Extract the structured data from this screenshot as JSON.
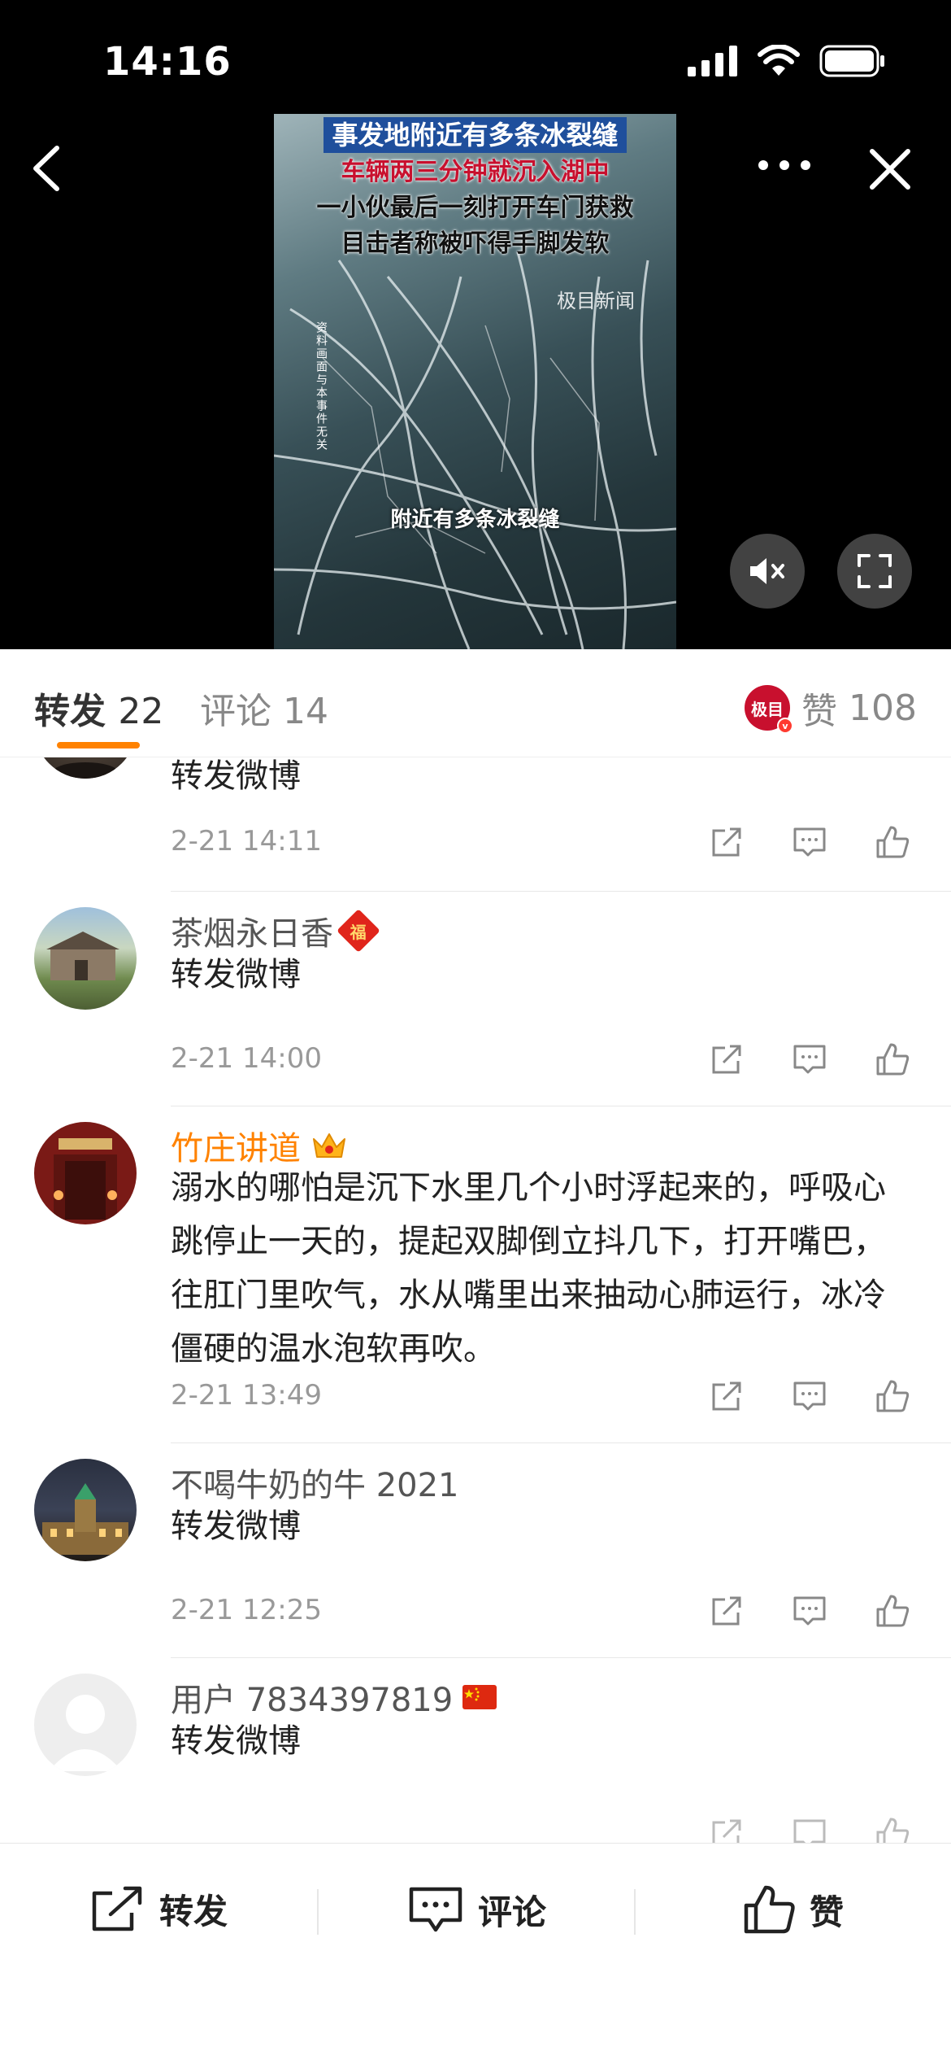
{
  "status_bar": {
    "time": "14:16"
  },
  "video": {
    "title_lines": [
      "事发地附近有多条冰裂缝",
      "车辆两三分钟就沉入湖中",
      "一小伙最后一刻打开车门获救",
      "目击者称被吓得手脚发软"
    ],
    "logo": "极目新闻",
    "side_note": "资料画面与本事件无关",
    "sub_caption": "附近有多条冰裂缝"
  },
  "tabs": {
    "repost_label": "转发",
    "repost_count": "22",
    "comment_label": "评论",
    "comment_count": "14",
    "like_label": "赞",
    "like_count": "108",
    "account_logo": "极目"
  },
  "items": [
    {
      "name": "",
      "text": "转发微博",
      "time": "2-21 14:11"
    },
    {
      "name": "茶烟永日香",
      "badge": "福",
      "text": "转发微博",
      "time": "2-21 14:00"
    },
    {
      "name": "竹庄讲道",
      "badge_icon": "crown-icon",
      "text": "溺水的哪怕是沉下水里几个小时浮起来的，呼吸心跳停止一天的，提起双脚倒立抖几下，打开嘴巴，往肛门里吹气，水从嘴里出来抽动心肺运行，冰冷僵硬的温水泡软再吹。",
      "time": "2-21 13:49"
    },
    {
      "name": "不喝牛奶的牛 2021",
      "text": "转发微博",
      "time": "2-21 12:25"
    },
    {
      "name": "用户 7834397819",
      "badge_icon": "china-flag-icon",
      "text": "转发微博",
      "time": ""
    }
  ],
  "bottom_bar": {
    "repost_label": "转发",
    "comment_label": "评论",
    "like_label": "赞"
  },
  "colors": {
    "accent": "#ff8200",
    "vip_name": "#ff8200",
    "brand_red": "#c8102e"
  }
}
